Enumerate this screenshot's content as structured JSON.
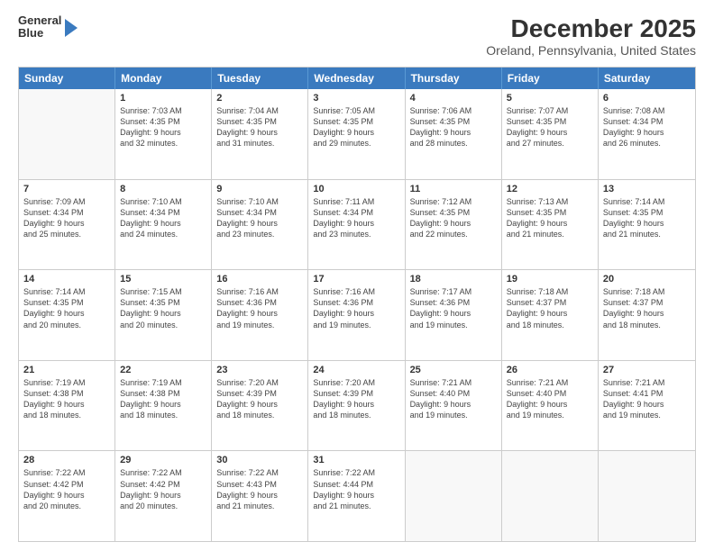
{
  "logo": {
    "line1": "General",
    "line2": "Blue"
  },
  "title": "December 2025",
  "subtitle": "Oreland, Pennsylvania, United States",
  "days_of_week": [
    "Sunday",
    "Monday",
    "Tuesday",
    "Wednesday",
    "Thursday",
    "Friday",
    "Saturday"
  ],
  "rows": [
    [
      {
        "num": "",
        "text": "",
        "empty": true
      },
      {
        "num": "1",
        "text": "Sunrise: 7:03 AM\nSunset: 4:35 PM\nDaylight: 9 hours\nand 32 minutes.",
        "empty": false
      },
      {
        "num": "2",
        "text": "Sunrise: 7:04 AM\nSunset: 4:35 PM\nDaylight: 9 hours\nand 31 minutes.",
        "empty": false
      },
      {
        "num": "3",
        "text": "Sunrise: 7:05 AM\nSunset: 4:35 PM\nDaylight: 9 hours\nand 29 minutes.",
        "empty": false
      },
      {
        "num": "4",
        "text": "Sunrise: 7:06 AM\nSunset: 4:35 PM\nDaylight: 9 hours\nand 28 minutes.",
        "empty": false
      },
      {
        "num": "5",
        "text": "Sunrise: 7:07 AM\nSunset: 4:35 PM\nDaylight: 9 hours\nand 27 minutes.",
        "empty": false
      },
      {
        "num": "6",
        "text": "Sunrise: 7:08 AM\nSunset: 4:34 PM\nDaylight: 9 hours\nand 26 minutes.",
        "empty": false
      }
    ],
    [
      {
        "num": "7",
        "text": "Sunrise: 7:09 AM\nSunset: 4:34 PM\nDaylight: 9 hours\nand 25 minutes.",
        "empty": false
      },
      {
        "num": "8",
        "text": "Sunrise: 7:10 AM\nSunset: 4:34 PM\nDaylight: 9 hours\nand 24 minutes.",
        "empty": false
      },
      {
        "num": "9",
        "text": "Sunrise: 7:10 AM\nSunset: 4:34 PM\nDaylight: 9 hours\nand 23 minutes.",
        "empty": false
      },
      {
        "num": "10",
        "text": "Sunrise: 7:11 AM\nSunset: 4:34 PM\nDaylight: 9 hours\nand 23 minutes.",
        "empty": false
      },
      {
        "num": "11",
        "text": "Sunrise: 7:12 AM\nSunset: 4:35 PM\nDaylight: 9 hours\nand 22 minutes.",
        "empty": false
      },
      {
        "num": "12",
        "text": "Sunrise: 7:13 AM\nSunset: 4:35 PM\nDaylight: 9 hours\nand 21 minutes.",
        "empty": false
      },
      {
        "num": "13",
        "text": "Sunrise: 7:14 AM\nSunset: 4:35 PM\nDaylight: 9 hours\nand 21 minutes.",
        "empty": false
      }
    ],
    [
      {
        "num": "14",
        "text": "Sunrise: 7:14 AM\nSunset: 4:35 PM\nDaylight: 9 hours\nand 20 minutes.",
        "empty": false
      },
      {
        "num": "15",
        "text": "Sunrise: 7:15 AM\nSunset: 4:35 PM\nDaylight: 9 hours\nand 20 minutes.",
        "empty": false
      },
      {
        "num": "16",
        "text": "Sunrise: 7:16 AM\nSunset: 4:36 PM\nDaylight: 9 hours\nand 19 minutes.",
        "empty": false
      },
      {
        "num": "17",
        "text": "Sunrise: 7:16 AM\nSunset: 4:36 PM\nDaylight: 9 hours\nand 19 minutes.",
        "empty": false
      },
      {
        "num": "18",
        "text": "Sunrise: 7:17 AM\nSunset: 4:36 PM\nDaylight: 9 hours\nand 19 minutes.",
        "empty": false
      },
      {
        "num": "19",
        "text": "Sunrise: 7:18 AM\nSunset: 4:37 PM\nDaylight: 9 hours\nand 18 minutes.",
        "empty": false
      },
      {
        "num": "20",
        "text": "Sunrise: 7:18 AM\nSunset: 4:37 PM\nDaylight: 9 hours\nand 18 minutes.",
        "empty": false
      }
    ],
    [
      {
        "num": "21",
        "text": "Sunrise: 7:19 AM\nSunset: 4:38 PM\nDaylight: 9 hours\nand 18 minutes.",
        "empty": false
      },
      {
        "num": "22",
        "text": "Sunrise: 7:19 AM\nSunset: 4:38 PM\nDaylight: 9 hours\nand 18 minutes.",
        "empty": false
      },
      {
        "num": "23",
        "text": "Sunrise: 7:20 AM\nSunset: 4:39 PM\nDaylight: 9 hours\nand 18 minutes.",
        "empty": false
      },
      {
        "num": "24",
        "text": "Sunrise: 7:20 AM\nSunset: 4:39 PM\nDaylight: 9 hours\nand 18 minutes.",
        "empty": false
      },
      {
        "num": "25",
        "text": "Sunrise: 7:21 AM\nSunset: 4:40 PM\nDaylight: 9 hours\nand 19 minutes.",
        "empty": false
      },
      {
        "num": "26",
        "text": "Sunrise: 7:21 AM\nSunset: 4:40 PM\nDaylight: 9 hours\nand 19 minutes.",
        "empty": false
      },
      {
        "num": "27",
        "text": "Sunrise: 7:21 AM\nSunset: 4:41 PM\nDaylight: 9 hours\nand 19 minutes.",
        "empty": false
      }
    ],
    [
      {
        "num": "28",
        "text": "Sunrise: 7:22 AM\nSunset: 4:42 PM\nDaylight: 9 hours\nand 20 minutes.",
        "empty": false
      },
      {
        "num": "29",
        "text": "Sunrise: 7:22 AM\nSunset: 4:42 PM\nDaylight: 9 hours\nand 20 minutes.",
        "empty": false
      },
      {
        "num": "30",
        "text": "Sunrise: 7:22 AM\nSunset: 4:43 PM\nDaylight: 9 hours\nand 21 minutes.",
        "empty": false
      },
      {
        "num": "31",
        "text": "Sunrise: 7:22 AM\nSunset: 4:44 PM\nDaylight: 9 hours\nand 21 minutes.",
        "empty": false
      },
      {
        "num": "",
        "text": "",
        "empty": true
      },
      {
        "num": "",
        "text": "",
        "empty": true
      },
      {
        "num": "",
        "text": "",
        "empty": true
      }
    ]
  ]
}
